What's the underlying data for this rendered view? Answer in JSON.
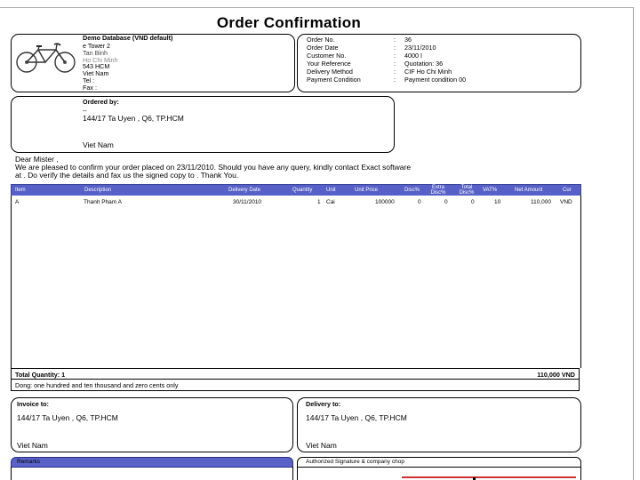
{
  "title": "Order Confirmation",
  "company": {
    "name": "Demo Database (VND default)",
    "line1": "e Tower 2",
    "line2": "Tan Binh",
    "line3": "Ho Chi Minh",
    "line4": "543 HCM",
    "line5": "Viet Nam",
    "tel": "Tel   :",
    "fax": "Fax   :"
  },
  "order_info": {
    "labels": [
      "Order No.",
      "Order Date",
      "Customer No.",
      "Your Reference",
      "Delivery Method",
      "Payment Condition"
    ],
    "colons": [
      ":",
      ":",
      ":",
      ":",
      ":",
      ":"
    ],
    "values": [
      "36",
      "23/11/2010",
      "4000 I",
      "Quotation: 36",
      "CIF Ho Chi Minh",
      "Payment condition 00"
    ]
  },
  "ordered_by": {
    "label": "Ordered by:",
    "line1": "--",
    "line2": "144/17 Ta Uyen , Q6, TP.HCM",
    "country": "Viet Nam"
  },
  "letter": {
    "salutation": "Dear Mister   ,",
    "line1": "We are pleased to confirm your order placed on 23/11/2010. Should you have any query, kindly contact  Exact software",
    "line2": "at  . Do verify the details and fax us the signed copy to   . Thank You."
  },
  "table": {
    "headers": [
      "Item",
      "Description",
      "Delivery Date",
      "Quantity",
      "Unit",
      "Unit Price",
      "Disc%",
      "Extra Disc%",
      "Total Disc%",
      "VAT%",
      "Net Amount",
      "Cur"
    ],
    "rows": [
      [
        "A",
        "Thanh Pham A",
        "30/11/2010",
        "1",
        "Cai",
        "100000",
        "0",
        "0",
        "0",
        "10",
        "110,000",
        "VND"
      ]
    ],
    "total_label": "Total Quantity:  1",
    "total_amount": "110,000 VND",
    "amount_in_words": "Dong: one hundred and ten thousand and zero cents only"
  },
  "invoice_to": {
    "label": "Invoice to:",
    "address": "144/17 Ta Uyen , Q6, TP.HCM",
    "country": "Viet Nam"
  },
  "delivery_to": {
    "label": "Delivery to:",
    "address": "144/17 Ta Uyen , Q6, TP.HCM",
    "country": "Viet Nam"
  },
  "remarks_label": "Remarks",
  "signature_label": "Authorized Signature & company chop",
  "colors": {
    "header_blue": "#5660c6",
    "red_line": "#d03030"
  }
}
